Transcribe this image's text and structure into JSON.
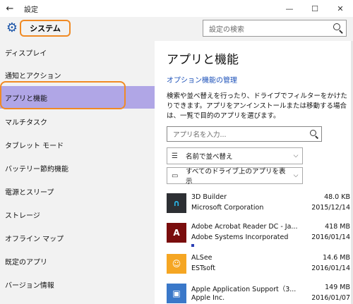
{
  "window": {
    "title": "設定",
    "back_glyph": "←",
    "controls": {
      "minimize": "—",
      "maximize": "☐",
      "close": "✕"
    }
  },
  "header": {
    "section_label": "システム",
    "search_placeholder": "設定の検索",
    "gear_glyph": "⚙"
  },
  "sidebar": {
    "items": [
      {
        "label": "ディスプレイ",
        "active": false
      },
      {
        "label": "通知とアクション",
        "active": false
      },
      {
        "label": "アプリと機能",
        "active": true
      },
      {
        "label": "マルチタスク",
        "active": false
      },
      {
        "label": "タブレット モード",
        "active": false
      },
      {
        "label": "バッテリー節約機能",
        "active": false
      },
      {
        "label": "電源とスリープ",
        "active": false
      },
      {
        "label": "ストレージ",
        "active": false
      },
      {
        "label": "オフライン マップ",
        "active": false
      },
      {
        "label": "既定のアプリ",
        "active": false
      },
      {
        "label": "バージョン情報",
        "active": false
      }
    ]
  },
  "main": {
    "title": "アプリと機能",
    "optional_features_link": "オプション機能の管理",
    "description": "検索や並べ替えを行ったり、ドライブでフィルターをかけたりできます。アプリをアンインストールまたは移動する場合は、一覧で目的のアプリを選びます。",
    "app_search_placeholder": "アプリ名を入力...",
    "sort_dropdown": {
      "icon": "☰",
      "label": "名前で並べ替え",
      "chevron": "⌵"
    },
    "drive_dropdown": {
      "icon": "▭",
      "label": "すべてのドライブ上のアプリを表示",
      "chevron": "⌵"
    },
    "apps": [
      {
        "name": "3D Builder",
        "publisher": "Microsoft Corporation",
        "size": "48.0 KB",
        "date": "2015/12/14",
        "icon": "3d-builder-icon",
        "icon_glyph": "∩",
        "icon_bg": "#2d2f33",
        "icon_fg": "#29b6e8"
      },
      {
        "name": "Adobe Acrobat Reader DC - Ja...",
        "publisher": "Adobe Systems Incorporated",
        "size": "418 MB",
        "date": "2016/01/14",
        "icon": "adobe-acrobat-icon",
        "icon_glyph": "A",
        "icon_bg": "#7a0d0d",
        "icon_fg": "#ffffff"
      },
      {
        "name": "ALSee",
        "publisher": "ESTsoft",
        "size": "14.6 MB",
        "date": "2016/01/14",
        "icon": "alsee-icon",
        "icon_glyph": "☺",
        "icon_bg": "#f5a623",
        "icon_fg": "#ffffff"
      },
      {
        "name": "Apple Application Support（3...",
        "publisher": "Apple Inc.",
        "size": "149 MB",
        "date": "2016/01/07",
        "icon": "apple-app-support-icon",
        "icon_glyph": "▣",
        "icon_bg": "#3a78c9",
        "icon_fg": "#ffffff"
      }
    ]
  },
  "colors": {
    "highlight_outline": "#f08a24",
    "active_item_bg": "#b0a6e6",
    "link": "#1a4fb8",
    "sidebar_bg": "#f2f2f2"
  }
}
